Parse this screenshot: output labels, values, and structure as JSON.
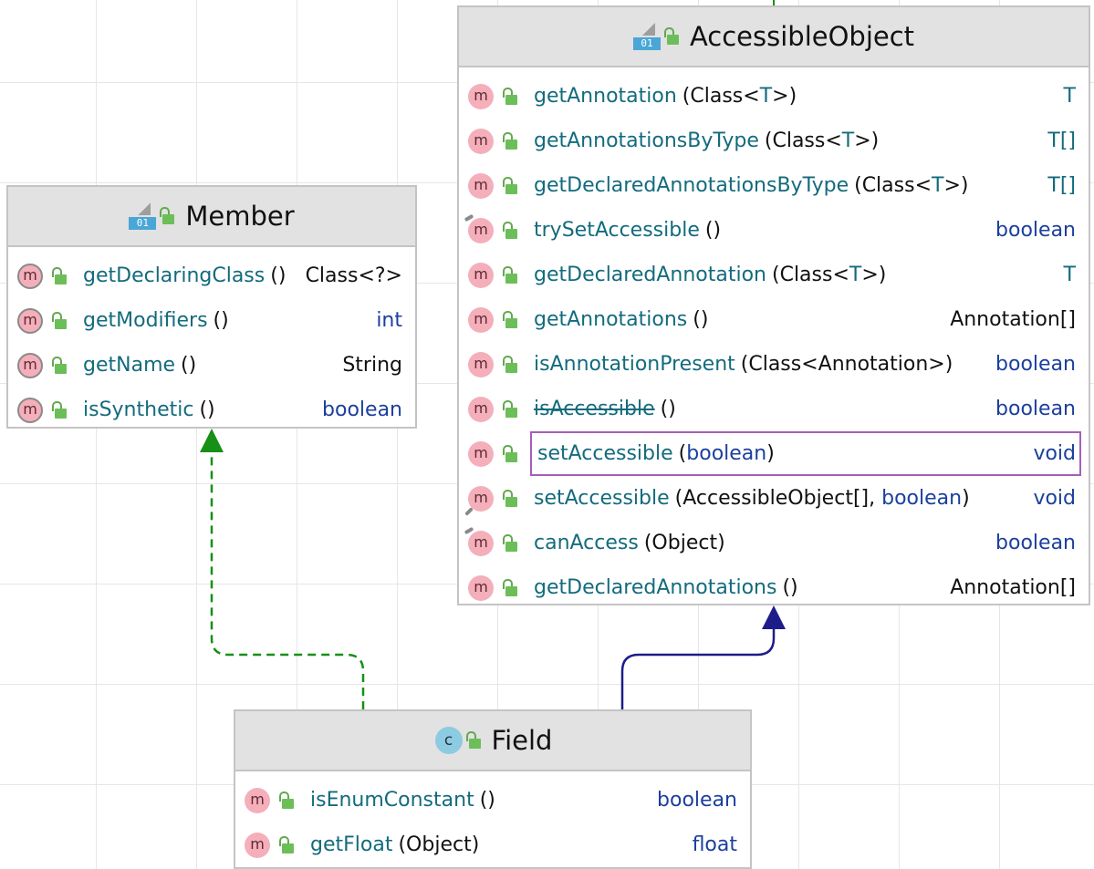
{
  "colors": {
    "accent_highlight": "#a55fb7",
    "implements_arrow": "#169016",
    "extends_arrow": "#1d1d8a"
  },
  "boxes": [
    {
      "id": "accessible-object",
      "title": "AccessibleObject",
      "kind": "interface",
      "methods": [
        {
          "name": "getAnnotation",
          "params": [
            {
              "t": "(Class<",
              "c": "p"
            },
            {
              "t": "T",
              "c": "tv"
            },
            {
              "t": ">)",
              "c": "p"
            }
          ],
          "ret": "T",
          "retc": "tv"
        },
        {
          "name": "getAnnotationsByType",
          "params": [
            {
              "t": "(Class<",
              "c": "p"
            },
            {
              "t": "T",
              "c": "tv"
            },
            {
              "t": ">)",
              "c": "p"
            }
          ],
          "ret": "T[]",
          "retc": "tv"
        },
        {
          "name": "getDeclaredAnnotationsByType",
          "params": [
            {
              "t": "(Class<",
              "c": "p"
            },
            {
              "t": "T",
              "c": "tv"
            },
            {
              "t": ">)",
              "c": "p"
            }
          ],
          "ret": "T[]",
          "retc": "tv"
        },
        {
          "name": "trySetAccessible",
          "params": [
            {
              "t": "()",
              "c": "p"
            }
          ],
          "ret": "boolean",
          "retc": "kw",
          "mark": "top"
        },
        {
          "name": "getDeclaredAnnotation",
          "params": [
            {
              "t": "(Class<",
              "c": "p"
            },
            {
              "t": "T",
              "c": "tv"
            },
            {
              "t": ">)",
              "c": "p"
            }
          ],
          "ret": "T",
          "retc": "tv"
        },
        {
          "name": "getAnnotations",
          "params": [
            {
              "t": "()",
              "c": "p"
            }
          ],
          "ret": "Annotation[]",
          "retc": "plain"
        },
        {
          "name": "isAnnotationPresent",
          "params": [
            {
              "t": "(Class<Annotation>)",
              "c": "p"
            }
          ],
          "ret": "boolean",
          "retc": "kw"
        },
        {
          "name": "isAccessible",
          "params": [
            {
              "t": "()",
              "c": "p"
            }
          ],
          "ret": "boolean",
          "retc": "kw",
          "strike": true
        },
        {
          "name": "setAccessible",
          "params": [
            {
              "t": "(",
              "c": "p"
            },
            {
              "t": "boolean",
              "c": "kw"
            },
            {
              "t": ")",
              "c": "p"
            }
          ],
          "ret": "void",
          "retc": "kw",
          "highlight": true
        },
        {
          "name": "setAccessible",
          "params": [
            {
              "t": "(AccessibleObject[], ",
              "c": "p"
            },
            {
              "t": "boolean",
              "c": "kw"
            },
            {
              "t": ")",
              "c": "p"
            }
          ],
          "ret": "void",
          "retc": "kw",
          "mark": "bottom"
        },
        {
          "name": "canAccess",
          "params": [
            {
              "t": "(Object)",
              "c": "p"
            }
          ],
          "ret": "boolean",
          "retc": "kw",
          "mark": "top"
        },
        {
          "name": "getDeclaredAnnotations",
          "params": [
            {
              "t": "()",
              "c": "p"
            }
          ],
          "ret": "Annotation[]",
          "retc": "plain"
        }
      ]
    },
    {
      "id": "member",
      "title": "Member",
      "kind": "interface",
      "methods": [
        {
          "name": "getDeclaringClass",
          "params": [
            {
              "t": "()",
              "c": "p"
            }
          ],
          "ret": "Class<?>",
          "retc": "plain",
          "outline": true
        },
        {
          "name": "getModifiers",
          "params": [
            {
              "t": "()",
              "c": "p"
            }
          ],
          "ret": "int",
          "retc": "kw",
          "outline": true
        },
        {
          "name": "getName",
          "params": [
            {
              "t": "()",
              "c": "p"
            }
          ],
          "ret": "String",
          "retc": "plain",
          "outline": true
        },
        {
          "name": "isSynthetic",
          "params": [
            {
              "t": "()",
              "c": "p"
            }
          ],
          "ret": "boolean",
          "retc": "kw",
          "outline": true
        }
      ]
    },
    {
      "id": "field",
      "title": "Field",
      "kind": "class",
      "methods": [
        {
          "name": "isEnumConstant",
          "params": [
            {
              "t": "()",
              "c": "p"
            }
          ],
          "ret": "boolean",
          "retc": "kw"
        },
        {
          "name": "getFloat",
          "params": [
            {
              "t": "(Object)",
              "c": "p"
            }
          ],
          "ret": "float",
          "retc": "kw"
        }
      ]
    }
  ],
  "icon_labels": {
    "interface_badge": "01",
    "class_badge": "c",
    "method_badge": "m"
  },
  "relations": [
    {
      "from": "field",
      "to": "member",
      "style": "dashed",
      "kind": "implements"
    },
    {
      "from": "field",
      "to": "accessible-object",
      "style": "solid",
      "kind": "extends"
    }
  ]
}
